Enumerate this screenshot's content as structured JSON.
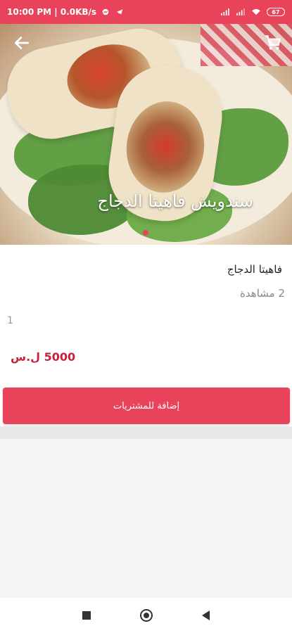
{
  "status_bar": {
    "time": "10:00 PM | 0.0KB/s",
    "battery": "67"
  },
  "product": {
    "image_title": "سندويش فاهيتا الدجاج",
    "name": "فاهيتا الدجاج",
    "views": "2 مشاهدة",
    "quantity": "1",
    "price": "5000 ل.س"
  },
  "actions": {
    "add_to_cart_label": "إضافة للمشتريات"
  },
  "icons": {
    "back": "arrow-left-icon",
    "cart": "cart-icon"
  },
  "colors": {
    "accent": "#e8435a",
    "price": "#c8223a"
  },
  "carousel": {
    "active_index": 0,
    "count": 1
  }
}
